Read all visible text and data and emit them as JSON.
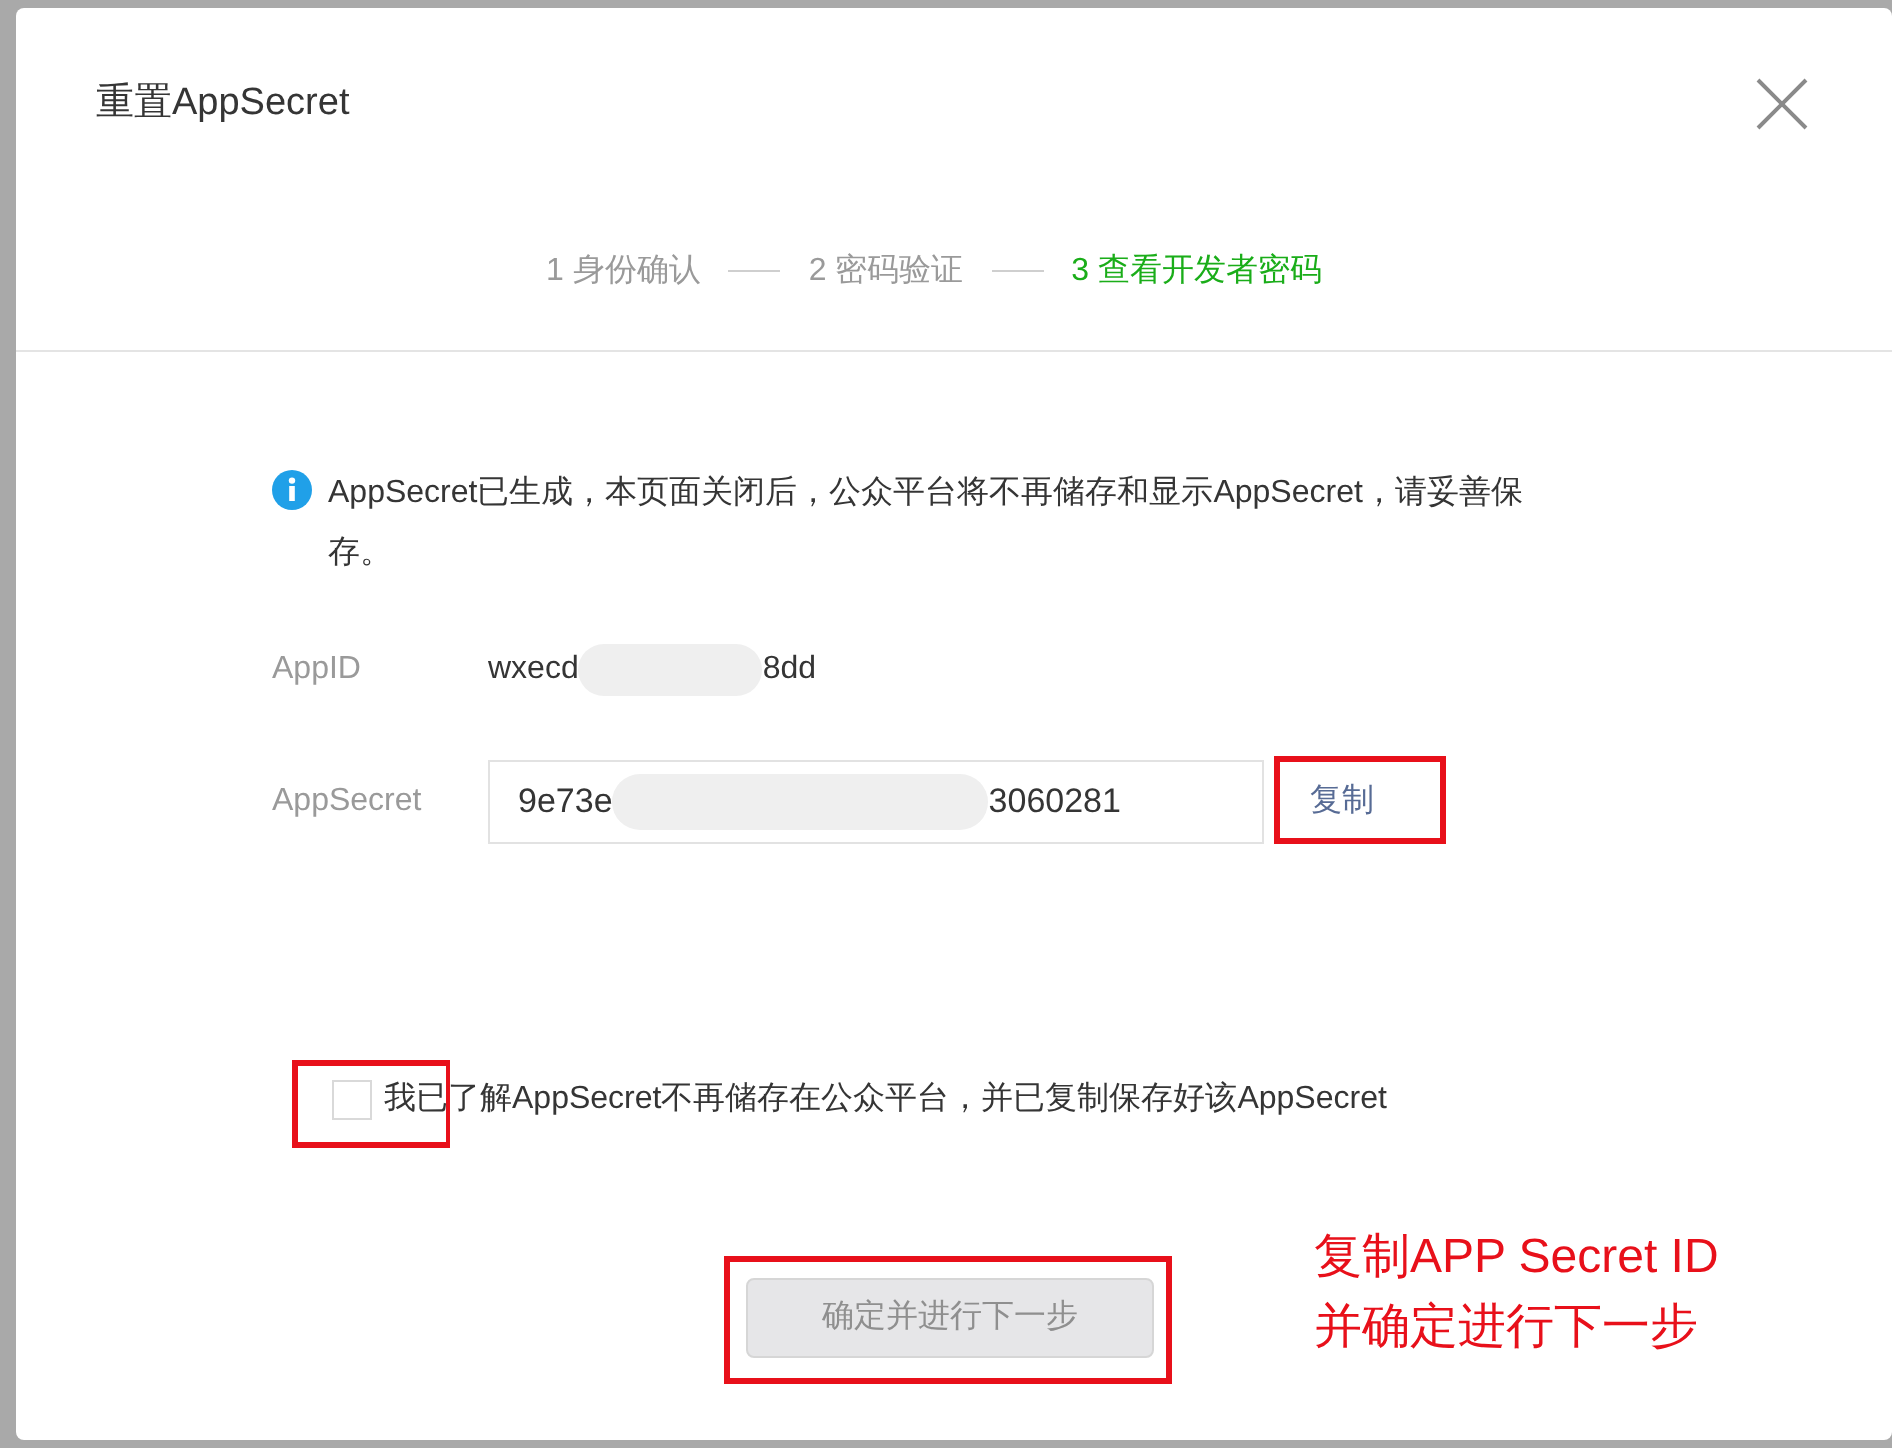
{
  "dialog": {
    "title": "重置AppSecret"
  },
  "steps": [
    {
      "number": "1",
      "label": "身份确认",
      "selected": false
    },
    {
      "number": "2",
      "label": "密码验证",
      "selected": false
    },
    {
      "number": "3",
      "label": "查看开发者密码",
      "selected": true
    }
  ],
  "notice": "AppSecret已生成，本页面关闭后，公众平台将不再储存和显示AppSecret，请妥善保存。",
  "app_id": {
    "label": "AppID",
    "value_start": "wxecd",
    "value_end": "8dd"
  },
  "app_secret": {
    "label": "AppSecret",
    "value_start": "9e73e",
    "value_end": "3060281",
    "copy_link": "复制"
  },
  "agreement": {
    "label": "我已了解AppSecret不再储存在公众平台，并已复制保存好该AppSecret",
    "checked": false
  },
  "confirm_button": {
    "label": "确定并进行下一步",
    "disabled": true
  },
  "annotation": [
    "复制APP Secret ID",
    "并确定进行下一步"
  ]
}
